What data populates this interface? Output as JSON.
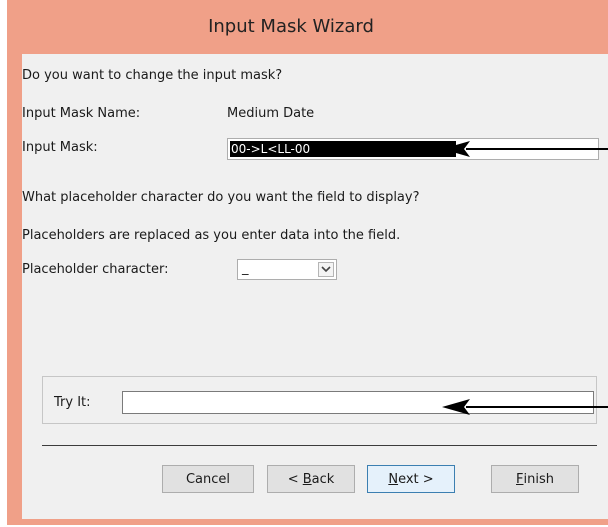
{
  "window": {
    "title": "Input Mask Wizard"
  },
  "question": "Do you want to change the input mask?",
  "mask_name": {
    "label": "Input Mask Name:",
    "value": "Medium Date"
  },
  "mask": {
    "label": "Input Mask:",
    "value": "00->L<LL-00"
  },
  "placeholder": {
    "question": "What placeholder character do you want the field to display?",
    "note": "Placeholders are replaced as you enter data into the field.",
    "label": "Placeholder character:",
    "value": "_"
  },
  "try_it": {
    "label": "Try It:",
    "value": ""
  },
  "buttons": {
    "cancel": "Cancel",
    "back_prefix": "< ",
    "back_key": "B",
    "back_rest": "ack",
    "next_key": "N",
    "next_rest": "ext >",
    "finish_key": "F",
    "finish_rest": "inish"
  },
  "colors": {
    "frame": "#f0a088",
    "client": "#f0f0f0",
    "selection": "#000000"
  },
  "icons": [
    "chevron-down-icon",
    "arrow-left-icon"
  ]
}
